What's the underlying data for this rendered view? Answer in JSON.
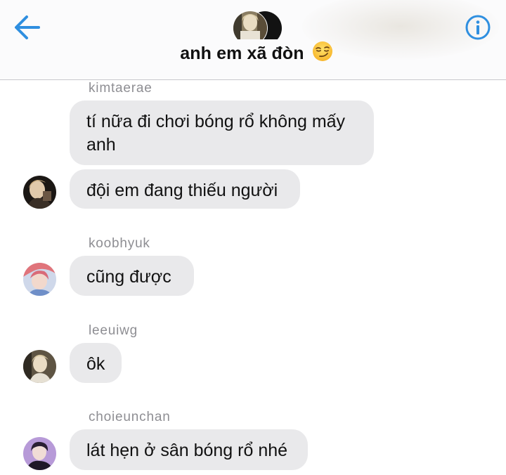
{
  "header": {
    "title": "anh em xã đòn",
    "title_emoji": "smirking-face-emoji",
    "back_icon": "back-arrow-icon",
    "info_icon": "info-icon",
    "accent_color": "#2f8fe0"
  },
  "messages": [
    {
      "sender": "kimtaerae",
      "bubbles": [
        "tí nữa đi chơi bóng rổ không mấy anh",
        "đội em đang thiếu người"
      ]
    },
    {
      "sender": "koobhyuk",
      "bubbles": [
        "cũng được"
      ]
    },
    {
      "sender": "leeuiwg",
      "bubbles": [
        "ôk"
      ]
    },
    {
      "sender": "choieunchan",
      "bubbles": [
        "lát hẹn ở sân bóng rổ nhé"
      ]
    }
  ],
  "colors": {
    "bubble_background": "#e9e9eb",
    "sender_name": "#8e8e93",
    "text": "#111111"
  }
}
